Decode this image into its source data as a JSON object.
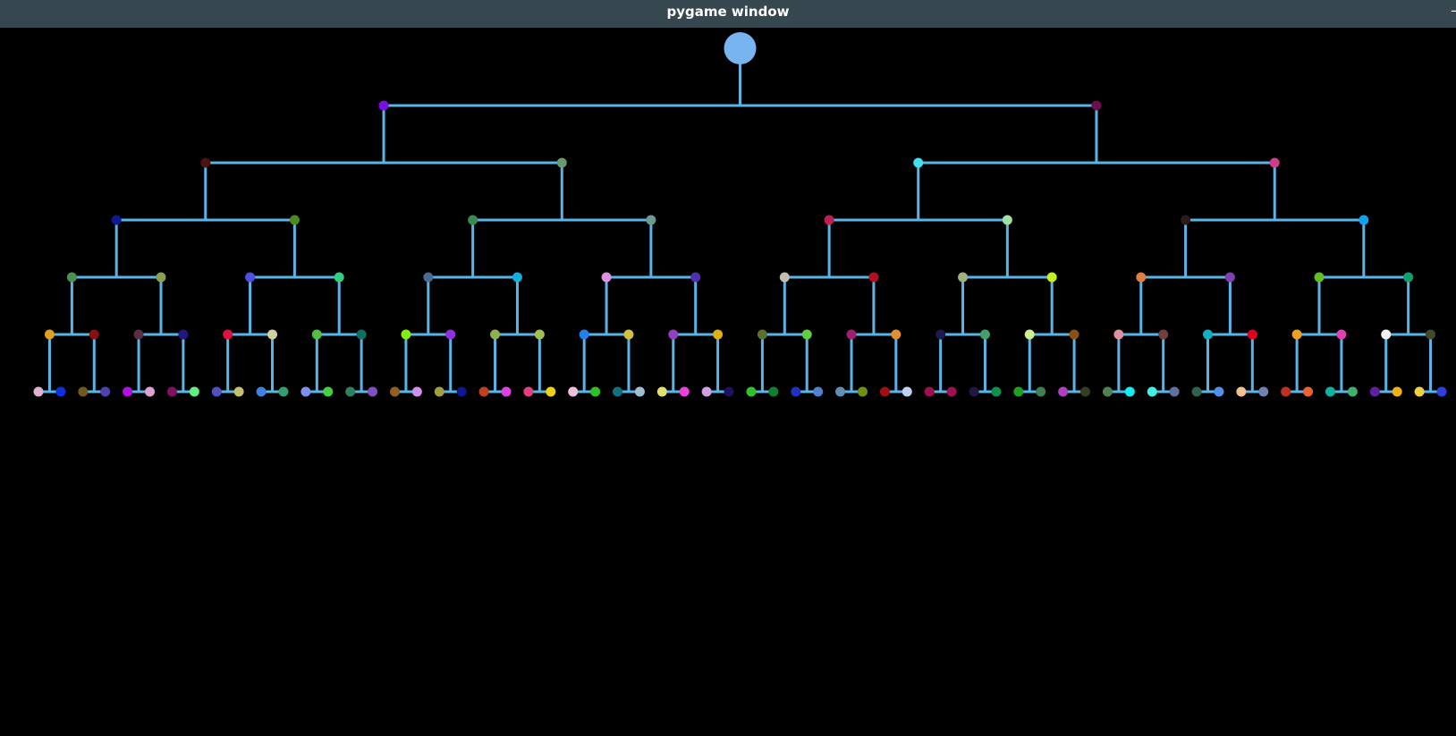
{
  "window": {
    "title": "pygame window",
    "control_label": "–"
  },
  "tree": {
    "type": "binary-tree",
    "depth": 6,
    "edge_color": "#5ab4e6",
    "root_color": "#78b4f0",
    "levels": [
      [
        "#78b4f0"
      ],
      [
        "#7a10e0",
        "#6a1050"
      ],
      [
        "#4a1410",
        "#6a9a70",
        "#40e0f0",
        "#d03c90"
      ],
      [
        "#101890",
        "#4a8a20",
        "#3a8a50",
        "#6a9a90",
        "#c02050",
        "#a0e0a0",
        "#2a1a1a",
        "#10a0f0"
      ],
      [
        "#4a9050",
        "#8aa050",
        "#5050e0",
        "#30d080",
        "#4a6a90",
        "#10b0e0",
        "#e090e0",
        "#5030b0",
        "#c0c0b0",
        "#b01020",
        "#a0b080",
        "#c0f020",
        "#e08040",
        "#8040b0",
        "#60c020",
        "#10a070"
      ],
      [
        "#e0a020",
        "#8a1010",
        "#5a3040",
        "#201880",
        "#e01040",
        "#d0d0a0",
        "#50c040",
        "#107060",
        "#80f010",
        "#9030e0",
        "#90b050",
        "#a0c050",
        "#2080f0",
        "#d0c040",
        "#9040c0",
        "#e0b010",
        "#5a7030",
        "#60d040",
        "#a02070",
        "#e09030",
        "#201850",
        "#40a070",
        "#d0f090",
        "#8a5010",
        "#e090a0",
        "#704040",
        "#10b0c0",
        "#e00020",
        "#f0a020",
        "#e040b0",
        "#f0f0f0",
        "#404a30"
      ],
      [
        "#e0b0d0",
        "#1030e0",
        "#705a20",
        "#5040b0",
        "#b010e0",
        "#e0a0d0",
        "#801060",
        "#60f080",
        "#5050c0",
        "#c0c070",
        "#4080e0",
        "#30a070",
        "#8090f0",
        "#40d040",
        "#308060",
        "#8050c0",
        "#906020",
        "#d090f0",
        "#a0a040",
        "#101890",
        "#c04020",
        "#e040e0",
        "#e04080",
        "#f0d010",
        "#f0c0e0",
        "#30c020",
        "#107080",
        "#a0c0d0",
        "#e0e070",
        "#f040e0",
        "#d0a0e0",
        "#201060",
        "#30c030",
        "#108030",
        "#2030c0",
        "#5080d0",
        "#6090b0",
        "#709010",
        "#a01010",
        "#c0d0f0",
        "#a01050",
        "#a01050",
        "#201840",
        "#109050",
        "#20a020",
        "#408050",
        "#b040c0",
        "#304020",
        "#508050",
        "#10f0f0",
        "#40f0e0",
        "#6070a0",
        "#306050",
        "#5090f0",
        "#f0c090",
        "#7080b0",
        "#c03020",
        "#f06030",
        "#10b0a0",
        "#40b070",
        "#6020a0",
        "#f0b010",
        "#f0d040",
        "#3040e0"
      ]
    ]
  }
}
